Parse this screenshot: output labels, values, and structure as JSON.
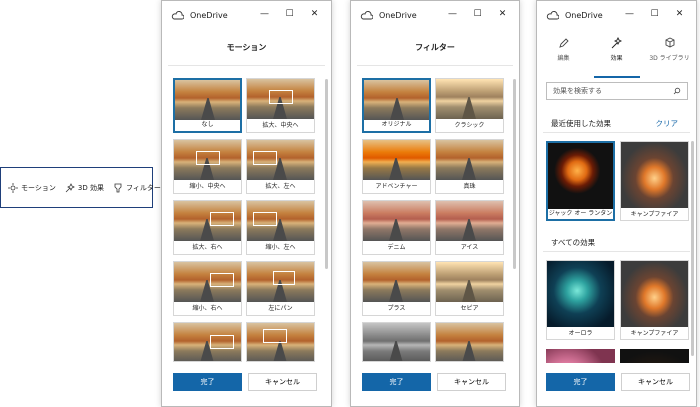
{
  "toolbar": {
    "items": [
      {
        "label": "モーション",
        "icon": "motion-icon"
      },
      {
        "label": "3D 効果",
        "icon": "effects-icon"
      },
      {
        "label": "フィルター",
        "icon": "filter-icon"
      }
    ]
  },
  "app_title": "OneDrive",
  "window_controls": {
    "minimize": "—",
    "maximize": "☐",
    "close": "✕"
  },
  "motion": {
    "title": "モーション",
    "items": [
      "なし",
      "拡大、中央へ",
      "縮小、中央へ",
      "拡大、左へ",
      "拡大、右へ",
      "縮小、左へ",
      "縮小、右へ",
      "左にパン",
      "",
      ""
    ]
  },
  "filter": {
    "title": "フィルター",
    "items": [
      "オリジナル",
      "クラシック",
      "アドベンチャー",
      "真珠",
      "デニム",
      "アイス",
      "プラス",
      "セピア",
      "",
      ""
    ]
  },
  "effects": {
    "tabs": [
      {
        "label": "編集",
        "icon": "pencil-icon"
      },
      {
        "label": "効果",
        "icon": "sparkle-icon"
      },
      {
        "label": "3D ライブラリ",
        "icon": "cube-icon"
      }
    ],
    "search_placeholder": "効果を検索する",
    "recent_heading": "最近使用した効果",
    "clear_label": "クリア",
    "recent": [
      "ジャック オー ランタン",
      "キャンプファイア"
    ],
    "all_heading": "すべての効果",
    "all": [
      "オーロラ",
      "キャンプファイア"
    ]
  },
  "buttons": {
    "done": "完了",
    "cancel": "キャンセル"
  },
  "colors": {
    "accent": "#1466a8",
    "selection": "#1d6fa5"
  }
}
